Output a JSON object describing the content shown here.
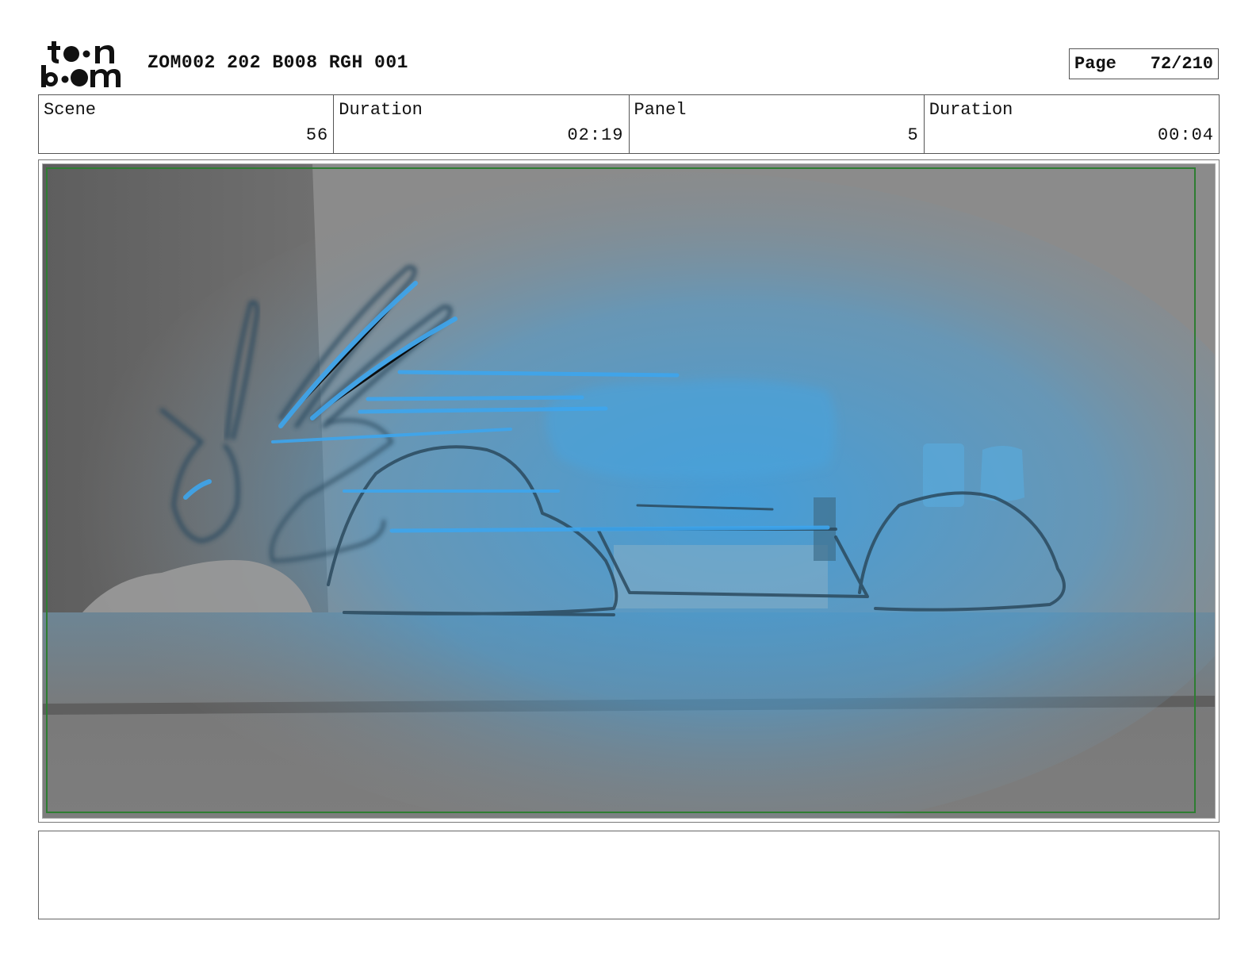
{
  "header": {
    "logo": {
      "line1": "toon",
      "line2": "boom"
    },
    "project_code": "ZOM002 202 B008 RGH 001",
    "page_label": "Page",
    "page_value": "72/210"
  },
  "info": {
    "scene_label": "Scene",
    "scene_value": "56",
    "scene_duration_label": "Duration",
    "scene_duration_value": "02:19",
    "panel_label": "Panel",
    "panel_value": "5",
    "panel_duration_label": "Duration",
    "panel_duration_value": "00:04"
  },
  "panel": {
    "frame_border_color": "#2e7d32",
    "glow_color": "#3d9fe0",
    "sketch_color": "#2b4a5e"
  },
  "caption": {
    "text": ""
  }
}
